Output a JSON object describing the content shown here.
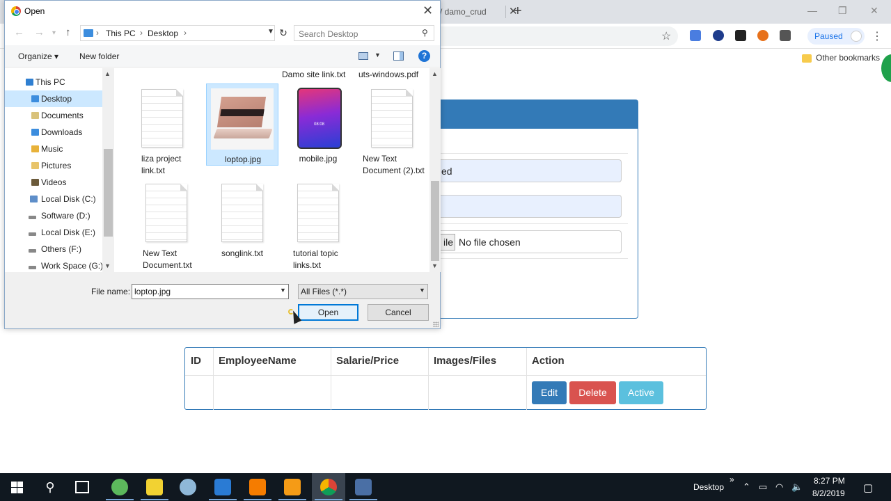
{
  "browser": {
    "tab_partial_label": "/ damo_crud",
    "tab_close": "✕",
    "new_tab": "+",
    "win_min": "—",
    "win_restore": "❐",
    "win_close": "✕",
    "profile_label": "Paused",
    "bookmark_label": "Other bookmarks"
  },
  "form": {
    "field1_partial": "ed",
    "file_button_partial": "ile",
    "file_status": "No file chosen"
  },
  "table": {
    "headers": [
      "ID",
      "EmployeeName",
      "Salarie/Price",
      "Images/Files",
      "Action"
    ],
    "buttons": {
      "edit": "Edit",
      "delete": "Delete",
      "active": "Active"
    },
    "colors": {
      "edit": "#337ab7",
      "delete": "#d9534f",
      "active": "#5bc0de"
    }
  },
  "dialog": {
    "title": "Open",
    "close": "✕",
    "breadcrumb": [
      "This PC",
      "Desktop"
    ],
    "search_placeholder": "Search Desktop",
    "organize_label": "Organize ▾",
    "new_folder_label": "New folder",
    "help_label": "?",
    "tree": [
      {
        "label": "This PC",
        "icon": "pc-icon"
      },
      {
        "label": "Desktop",
        "icon": "desktop-folder-icon",
        "selected": true
      },
      {
        "label": "Documents",
        "icon": "documents-folder-icon"
      },
      {
        "label": "Downloads",
        "icon": "downloads-folder-icon"
      },
      {
        "label": "Music",
        "icon": "music-folder-icon"
      },
      {
        "label": "Pictures",
        "icon": "pictures-folder-icon"
      },
      {
        "label": "Videos",
        "icon": "videos-folder-icon"
      },
      {
        "label": "Local Disk (C:)",
        "icon": "system-drive-icon"
      },
      {
        "label": "Software (D:)",
        "icon": "drive-icon"
      },
      {
        "label": "Local Disk (E:)",
        "icon": "drive-icon"
      },
      {
        "label": "Others (F:)",
        "icon": "drive-icon"
      },
      {
        "label": "Work Space (G:)",
        "icon": "drive-icon"
      }
    ],
    "top_labels": [
      "Damo site link.txt",
      "uts-windows.pdf"
    ],
    "files": [
      {
        "line1": "liza project",
        "line2": "link.txt",
        "kind": "text-file-icon"
      },
      {
        "line1": "loptop.jpg",
        "line2": "",
        "kind": "laptop-thumbnail",
        "selected": true
      },
      {
        "line1": "mobile.jpg",
        "line2": "",
        "kind": "phone-thumbnail"
      },
      {
        "line1": "New Text",
        "line2": "Document (2).txt",
        "kind": "text-file-icon"
      },
      {
        "line1": "New Text",
        "line2": "Document.txt",
        "kind": "text-file-icon"
      },
      {
        "line1": "songlink.txt",
        "line2": "",
        "kind": "text-file-icon"
      },
      {
        "line1": "tutorial topic",
        "line2": "links.txt",
        "kind": "text-file-icon"
      }
    ],
    "phone_time": "08:08",
    "file_name_label": "File name:",
    "file_name_value": "loptop.jpg",
    "file_type_value": "All Files (*.*)",
    "open_label": "Open",
    "cancel_label": "Cancel"
  },
  "taskbar": {
    "desktop_label": "Desktop",
    "time": "8:27 PM",
    "date": "8/2/2019",
    "overflow": "»"
  }
}
